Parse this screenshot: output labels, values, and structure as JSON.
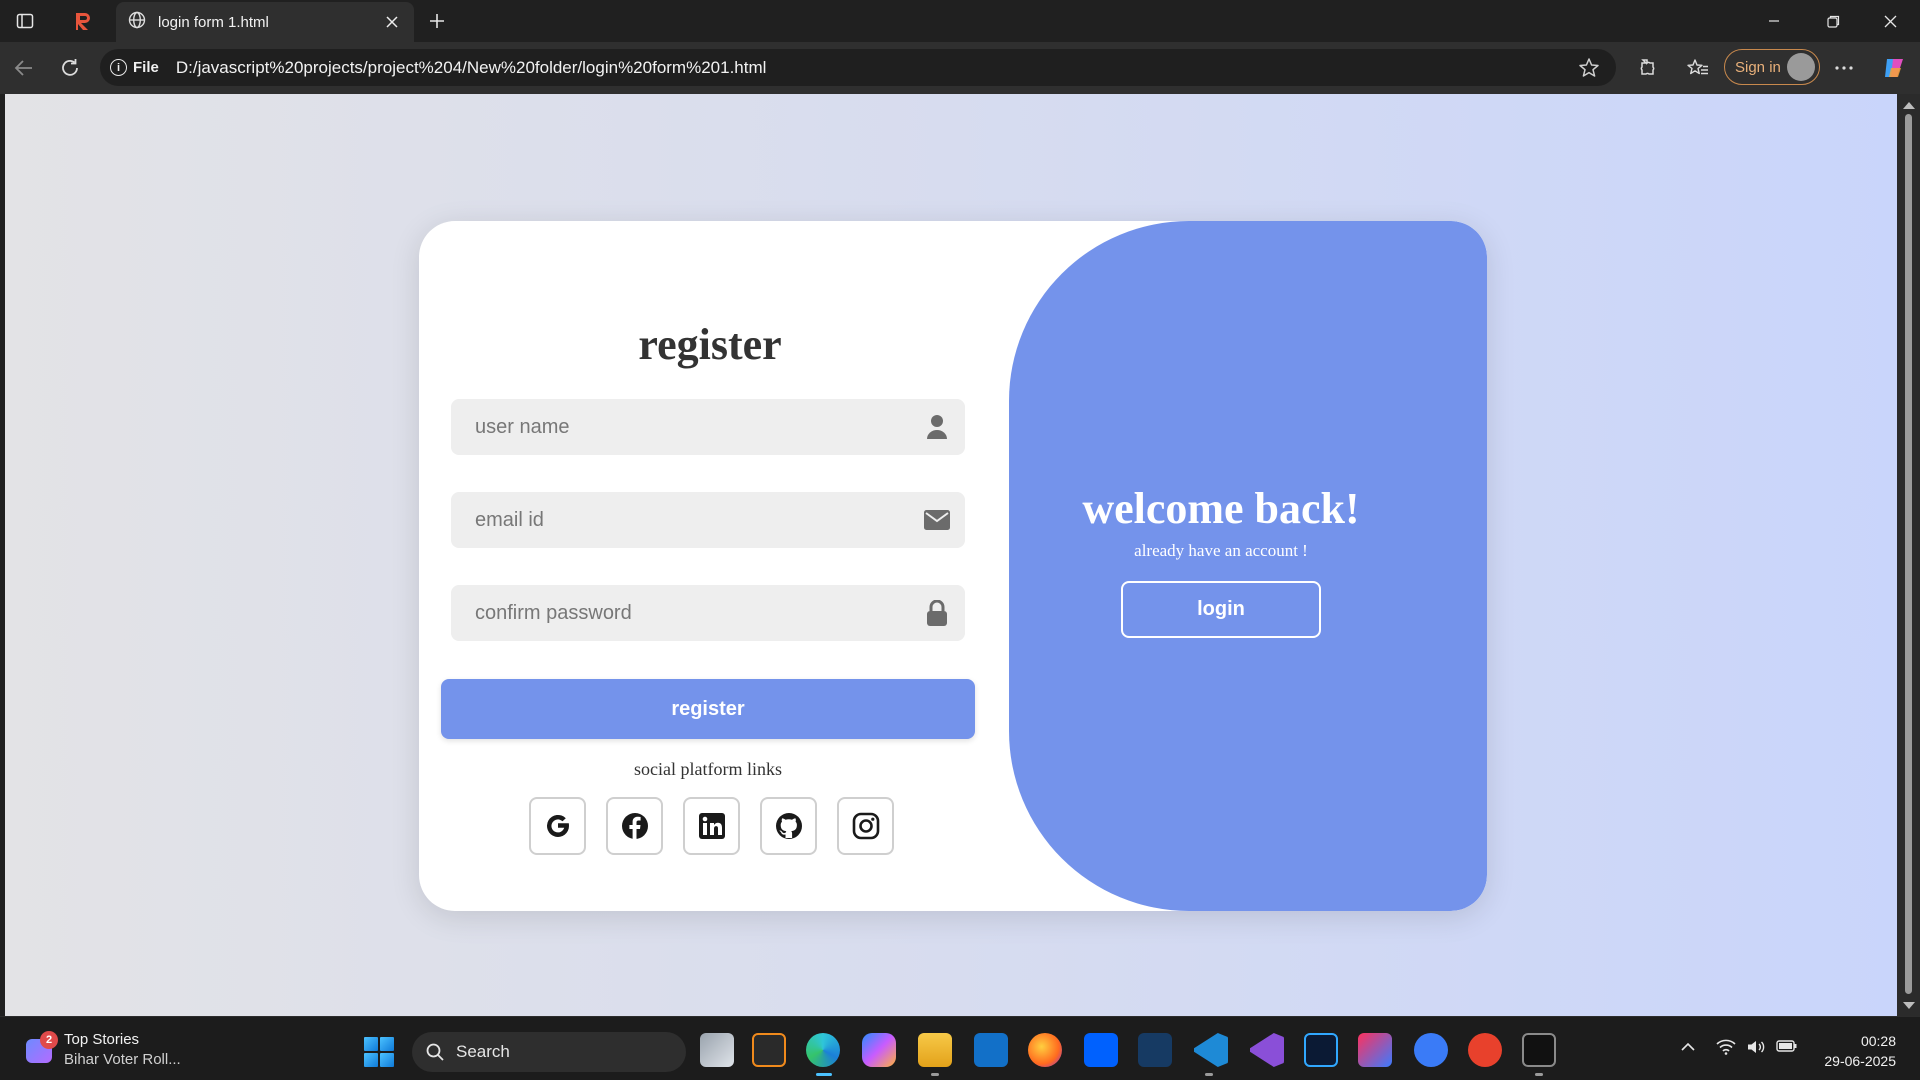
{
  "browser": {
    "tab_title": "login form 1.html",
    "file_label": "File",
    "url": "D:/javascript%20projects/project%204/New%20folder/login%20form%201.html",
    "signin_label": "Sign in"
  },
  "page": {
    "form_title": "register",
    "fields": [
      {
        "placeholder": "user name",
        "icon": "user-icon"
      },
      {
        "placeholder": "email id",
        "icon": "envelope-icon"
      },
      {
        "placeholder": "confirm password",
        "icon": "lock-icon"
      }
    ],
    "register_button": "register",
    "social_title": "social platform links",
    "social_links": [
      "google-icon",
      "facebook-icon",
      "linkedin-icon",
      "github-icon",
      "instagram-icon"
    ],
    "panel_title": "welcome back!",
    "panel_subtitle": "already have an account !",
    "login_button": "login",
    "colors": {
      "accent": "#7493eb",
      "card": "#ffffff",
      "field_bg": "#eeeeee"
    }
  },
  "taskbar": {
    "news_badge": "2",
    "news_title": "Top Stories",
    "news_subtitle": "Bihar Voter Roll...",
    "search_label": "Search",
    "time": "00:28",
    "date": "29-06-2025"
  }
}
